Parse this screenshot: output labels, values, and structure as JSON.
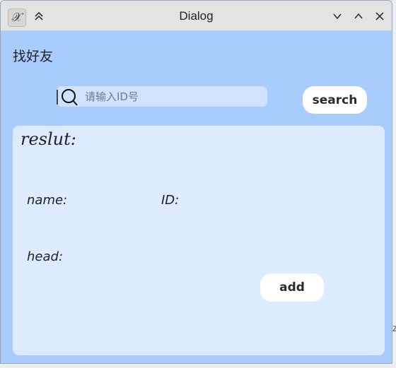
{
  "window": {
    "title": "Dialog",
    "app_icon_glyph": "𝒳"
  },
  "titlebar_buttons": {
    "shade_glyph": "⌃⌃",
    "minimize_glyph": "⌄",
    "maximize_glyph": "⌃",
    "close_glyph": "✕"
  },
  "page": {
    "heading": "找好友"
  },
  "search": {
    "placeholder": "请输入ID号",
    "button_label": "search"
  },
  "result": {
    "title": "reslut:",
    "name_label": "name:",
    "id_label": "ID:",
    "head_label": "head:",
    "add_label": "add"
  },
  "stray": {
    "char": "z"
  },
  "colors": {
    "window_bg": "#a9ccff",
    "panel_bg": "#dcebff",
    "search_bg": "#cfe2ff",
    "button_bg": "#ffffff",
    "titlebar_bg": "#e3e3e3"
  }
}
